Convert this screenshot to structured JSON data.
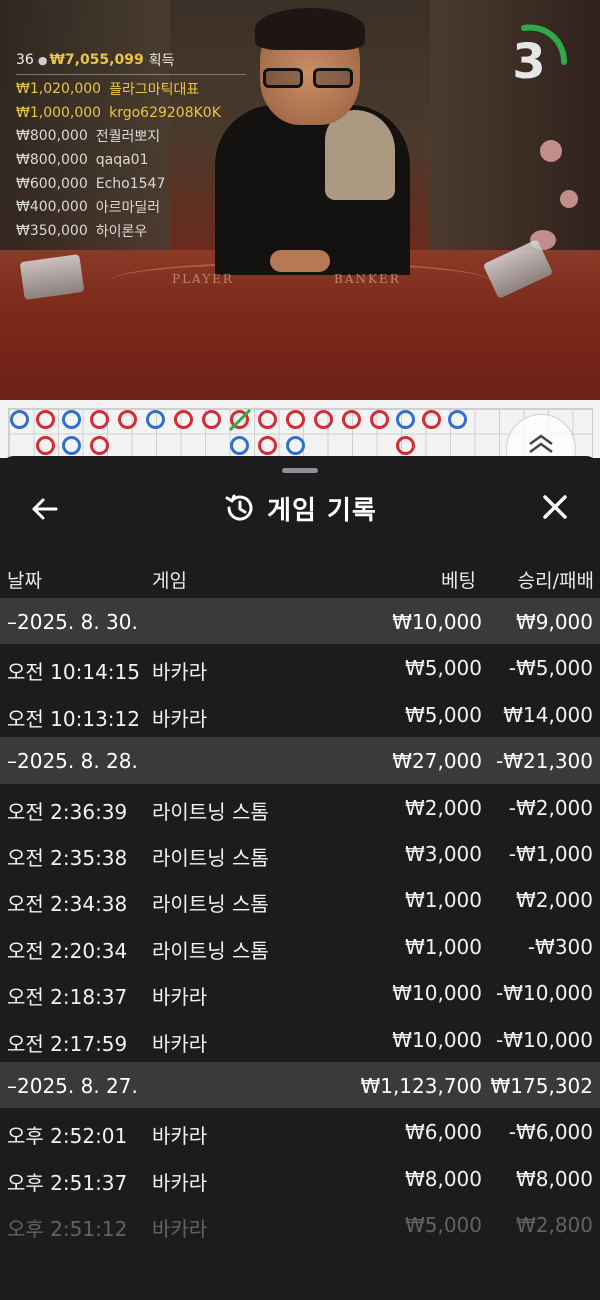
{
  "video": {
    "countdown": "3",
    "felt_player": "PLAYER",
    "felt_banker": "BANKER",
    "winners_header": {
      "count": "36",
      "total": "₩7,055,099",
      "gain_label": "획득"
    },
    "winners": [
      {
        "amount": "₩1,020,000",
        "name": "플라그마틱대표",
        "highlight": true
      },
      {
        "amount": "₩1,000,000",
        "name": "krgo629208K0K",
        "highlight": true
      },
      {
        "amount": "₩800,000",
        "name": "전퀄러뽀지",
        "highlight": false
      },
      {
        "amount": "₩800,000",
        "name": "qaqa01",
        "highlight": false
      },
      {
        "amount": "₩600,000",
        "name": "Echo1547",
        "highlight": false
      },
      {
        "amount": "₩400,000",
        "name": "아르마딜러",
        "highlight": false
      },
      {
        "amount": "₩350,000",
        "name": "하이론우",
        "highlight": false
      }
    ]
  },
  "road": {
    "colors": {
      "banker": "#d52b35",
      "player": "#2f6fd0"
    },
    "row1": [
      "player",
      "red",
      "player-dot",
      "red",
      "red",
      "player",
      "red",
      "red",
      "red-slash",
      "red",
      "red",
      "red",
      "red",
      "red",
      "player-dot",
      "red",
      "player"
    ],
    "row2": [
      "red",
      "player",
      "red",
      "",
      "",
      "",
      "",
      "",
      "player",
      "red",
      "player",
      "",
      "",
      "",
      "red-dot"
    ]
  },
  "sheet": {
    "title": "게임 기록",
    "columns": {
      "date": "날짜",
      "game": "게임",
      "bet": "베팅",
      "result": "승리/패배"
    },
    "groups": [
      {
        "date": "–2025. 8. 30.",
        "bet": "₩10,000",
        "result": "₩9,000",
        "items": [
          {
            "time": "오전 10:14:15",
            "game": "바카라",
            "bet": "₩5,000",
            "result": "-₩5,000"
          },
          {
            "time": "오전 10:13:12",
            "game": "바카라",
            "bet": "₩5,000",
            "result": "₩14,000"
          }
        ]
      },
      {
        "date": "–2025. 8. 28.",
        "bet": "₩27,000",
        "result": "-₩21,300",
        "items": [
          {
            "time": "오전 2:36:39",
            "game": "라이트닝 스톰",
            "bet": "₩2,000",
            "result": "-₩2,000"
          },
          {
            "time": "오전 2:35:38",
            "game": "라이트닝 스톰",
            "bet": "₩3,000",
            "result": "-₩1,000"
          },
          {
            "time": "오전 2:34:38",
            "game": "라이트닝 스톰",
            "bet": "₩1,000",
            "result": "₩2,000"
          },
          {
            "time": "오전 2:20:34",
            "game": "라이트닝 스톰",
            "bet": "₩1,000",
            "result": "-₩300"
          },
          {
            "time": "오전 2:18:37",
            "game": "바카라",
            "bet": "₩10,000",
            "result": "-₩10,000"
          },
          {
            "time": "오전 2:17:59",
            "game": "바카라",
            "bet": "₩10,000",
            "result": "-₩10,000"
          }
        ]
      },
      {
        "date": "–2025. 8. 27.",
        "bet": "₩1,123,700",
        "result": "₩175,302",
        "items": [
          {
            "time": "오후 2:52:01",
            "game": "바카라",
            "bet": "₩6,000",
            "result": "-₩6,000"
          },
          {
            "time": "오후 2:51:37",
            "game": "바카라",
            "bet": "₩8,000",
            "result": "₩8,000"
          },
          {
            "time": "오후 2:51:12",
            "game": "바카라",
            "bet": "₩5,000",
            "result": "₩2,800"
          }
        ]
      }
    ],
    "icons": {
      "back": "arrow-left-icon",
      "history": "history-clock-icon",
      "close": "close-icon",
      "scroll": "chevron-up-icon"
    }
  }
}
